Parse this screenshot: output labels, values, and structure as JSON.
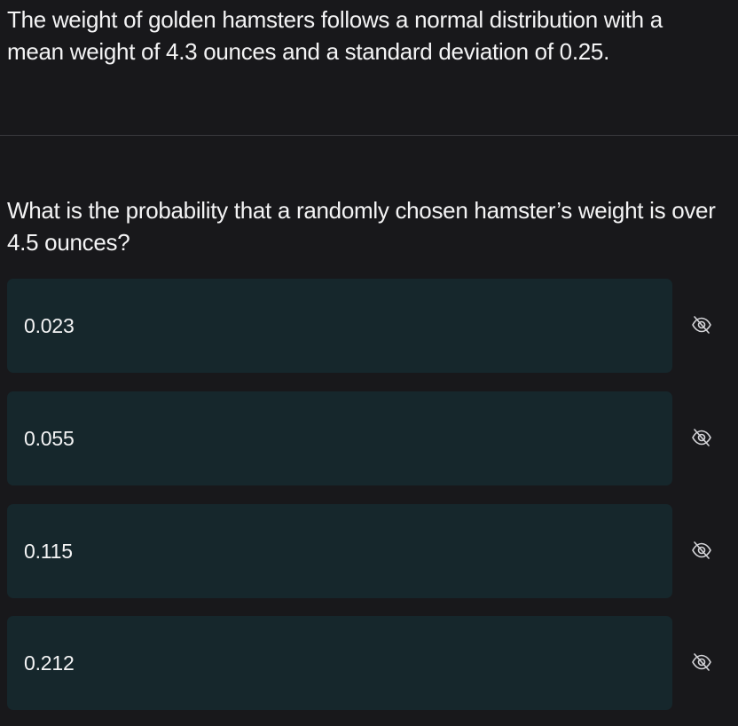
{
  "question": {
    "passage": "The weight of golden hamsters follows a normal distribution with a mean weight of 4.3 ounces and a standard deviation of 0.25.",
    "prompt": "What is the probability that a randomly chosen hamster’s weight is over 4.5 ounces?"
  },
  "choices": [
    {
      "label": "0.023",
      "hide_icon": "eye-slash-icon"
    },
    {
      "label": "0.055",
      "hide_icon": "eye-slash-icon"
    },
    {
      "label": "0.115",
      "hide_icon": "eye-slash-icon"
    },
    {
      "label": "0.212",
      "hide_icon": "eye-slash-icon"
    }
  ],
  "colors": {
    "background": "#18181b",
    "choice_background": "#16272c",
    "text": "#f4f4f5",
    "divider": "#3a3a3e"
  }
}
